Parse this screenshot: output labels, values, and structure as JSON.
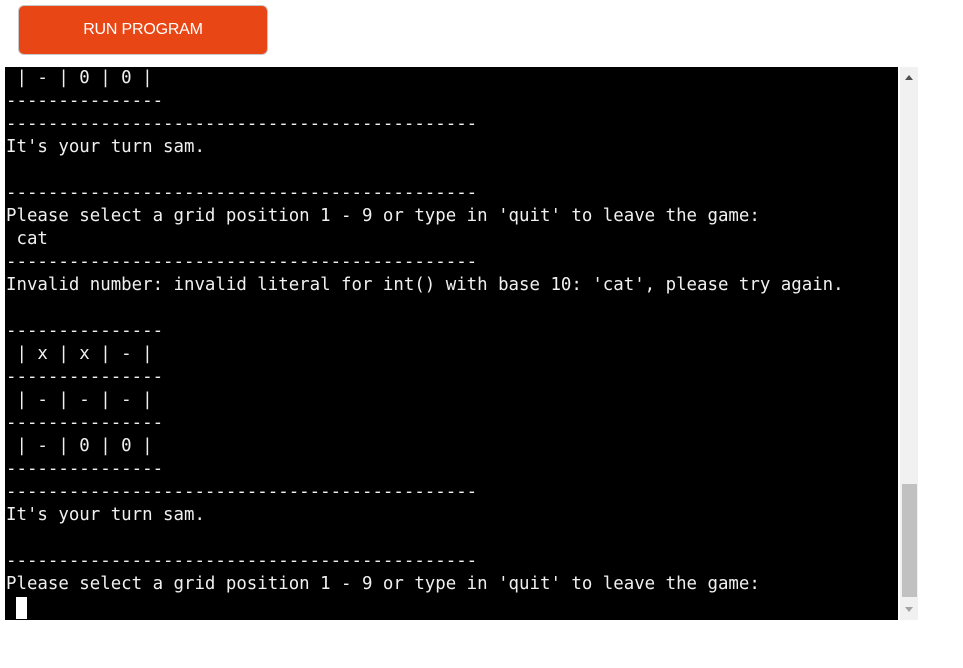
{
  "run_button": {
    "label": "RUN PROGRAM",
    "color": "#e84614"
  },
  "terminal": {
    "background": "#000000",
    "text_color": "#f0f0f0",
    "lines": [
      " | - | 0 | 0 |",
      "---------------",
      "---------------------------------------------",
      "It's your turn sam.",
      "",
      "---------------------------------------------",
      "Please select a grid position 1 - 9 or type in 'quit' to leave the game:",
      " cat",
      "---------------------------------------------",
      "Invalid number: invalid literal for int() with base 10: 'cat', please try again.",
      "",
      "---------------",
      " | x | x | - |",
      "---------------",
      " | - | - | - |",
      "---------------",
      " | - | 0 | 0 |",
      "---------------",
      "---------------------------------------------",
      "It's your turn sam.",
      "",
      "---------------------------------------------",
      "Please select a grid position 1 - 9 or type in 'quit' to leave the game:"
    ]
  },
  "scrollbar": {
    "up_icon": "triangle-up-icon",
    "down_icon": "triangle-down-icon",
    "position_fraction": 0.95
  }
}
